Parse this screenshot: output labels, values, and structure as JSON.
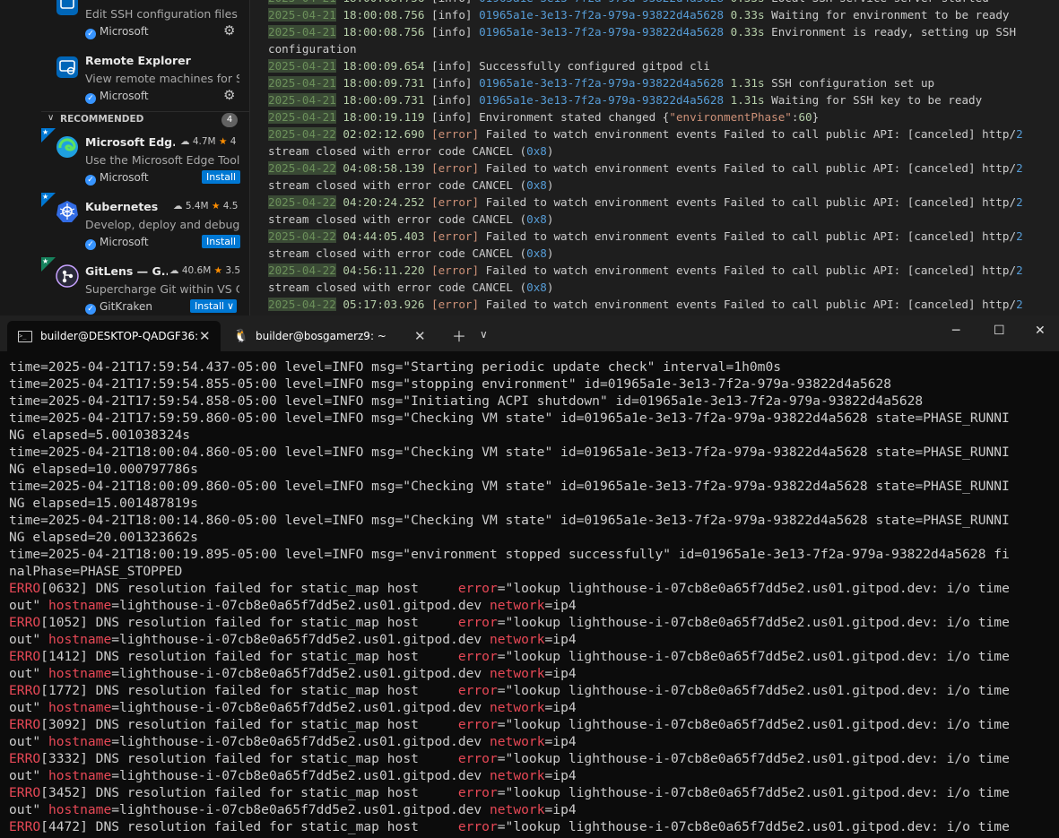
{
  "sidebar": {
    "installed": [
      {
        "title": "",
        "desc": "Edit SSH configuration files",
        "publisher": "Microsoft"
      },
      {
        "title": "Remote Explorer",
        "desc": "View remote machines for S...",
        "publisher": "Microsoft"
      }
    ],
    "recommended_label": "RECOMMENDED",
    "recommended_count": "4",
    "recommended": [
      {
        "title": "Microsoft Edg...",
        "downloads": "4.7M",
        "rating": "4",
        "desc": "Use the Microsoft Edge Tool...",
        "publisher": "Microsoft",
        "install": "Install"
      },
      {
        "title": "Kubernetes",
        "downloads": "5.4M",
        "rating": "4.5",
        "desc": "Develop, deploy and debug ...",
        "publisher": "Microsoft",
        "install": "Install"
      },
      {
        "title": "GitLens — G...",
        "downloads": "40.6M",
        "rating": "3.5",
        "desc": "Supercharge Git within VS C...",
        "publisher": "GitKraken",
        "install": "Install"
      }
    ]
  },
  "output_lines": [
    {
      "d": "2025-04-21",
      "t": " 18:00:08.756 ",
      "lvl": "[info]",
      "id": "01965a1e-3e13-7f2a-979a-93822d4a5628",
      "num": "0.33s",
      "rest": " Local SSH service server started"
    },
    {
      "d": "2025-04-21",
      "t": " 18:00:08.756 ",
      "lvl": "[info]",
      "id": "01965a1e-3e13-7f2a-979a-93822d4a5628",
      "num": "0.33s",
      "rest": " Waiting for environment to be ready"
    },
    {
      "d": "2025-04-21",
      "t": " 18:00:08.756 ",
      "lvl": "[info]",
      "id": "01965a1e-3e13-7f2a-979a-93822d4a5628",
      "num": "0.33s",
      "rest": " Environment is ready, setting up SSH"
    },
    {
      "plain": "configuration"
    },
    {
      "d": "2025-04-21",
      "t": " 18:00:09.654 ",
      "lvl": "[info]",
      "rest": "Successfully configured gitpod cli"
    },
    {
      "d": "2025-04-21",
      "t": " 18:00:09.731 ",
      "lvl": "[info]",
      "id": "01965a1e-3e13-7f2a-979a-93822d4a5628",
      "num": "1.31s",
      "rest": " SSH configuration set up"
    },
    {
      "d": "2025-04-21",
      "t": " 18:00:09.731 ",
      "lvl": "[info]",
      "id": "01965a1e-3e13-7f2a-979a-93822d4a5628",
      "num": "1.31s",
      "rest": " Waiting for SSH key to be ready"
    },
    {
      "d": "2025-04-21",
      "t": " 18:00:19.119 ",
      "lvl": "[info]",
      "rest": "Environment stated changed {",
      "str": "\"environmentPhase\"",
      "rest2": ":",
      "num2": "60",
      "rest3": "}"
    },
    {
      "d": "2025-04-22",
      "t": " 02:02:12.690 ",
      "lvl": "[error]",
      "err": true,
      "rest": "Failed to watch environment events Failed to call public API: [canceled] http/",
      "num": "2"
    },
    {
      "cont": "stream closed with error code CANCEL (",
      "hex": "0x8",
      "close": ")"
    },
    {
      "d": "2025-04-22",
      "t": " 04:08:58.139 ",
      "lvl": "[error]",
      "err": true,
      "rest": "Failed to watch environment events Failed to call public API: [canceled] http/",
      "num": "2"
    },
    {
      "cont": "stream closed with error code CANCEL (",
      "hex": "0x8",
      "close": ")"
    },
    {
      "d": "2025-04-22",
      "t": " 04:20:24.252 ",
      "lvl": "[error]",
      "err": true,
      "rest": "Failed to watch environment events Failed to call public API: [canceled] http/",
      "num": "2"
    },
    {
      "cont": "stream closed with error code CANCEL (",
      "hex": "0x8",
      "close": ")"
    },
    {
      "d": "2025-04-22",
      "t": " 04:44:05.403 ",
      "lvl": "[error]",
      "err": true,
      "rest": "Failed to watch environment events Failed to call public API: [canceled] http/",
      "num": "2"
    },
    {
      "cont": "stream closed with error code CANCEL (",
      "hex": "0x8",
      "close": ")"
    },
    {
      "d": "2025-04-22",
      "t": " 04:56:11.220 ",
      "lvl": "[error]",
      "err": true,
      "rest": "Failed to watch environment events Failed to call public API: [canceled] http/",
      "num": "2"
    },
    {
      "cont": "stream closed with error code CANCEL (",
      "hex": "0x8",
      "close": ")"
    },
    {
      "d": "2025-04-22",
      "t": " 05:17:03.926 ",
      "lvl": "[error]",
      "err": true,
      "rest": "Failed to watch environment events Failed to call public API: [canceled] http/",
      "num": "2"
    }
  ],
  "tabs": [
    {
      "label": "builder@DESKTOP-QADGF36:",
      "active": true
    },
    {
      "label": "builder@bosgamerz9: ~",
      "active": false
    }
  ],
  "terminal_lines": [
    {
      "text": "time=2025-04-21T17:59:54.437-05:00 level=INFO msg=\"Starting periodic update check\" interval=1h0m0s"
    },
    {
      "text": "time=2025-04-21T17:59:54.855-05:00 level=INFO msg=\"stopping environment\" id=01965a1e-3e13-7f2a-979a-93822d4a5628"
    },
    {
      "text": "time=2025-04-21T17:59:54.858-05:00 level=INFO msg=\"Initiating ACPI shutdown\" id=01965a1e-3e13-7f2a-979a-93822d4a5628"
    },
    {
      "text": "time=2025-04-21T17:59:59.860-05:00 level=INFO msg=\"Checking VM state\" id=01965a1e-3e13-7f2a-979a-93822d4a5628 state=PHASE_RUNNI"
    },
    {
      "text": "NG elapsed=5.001038324s"
    },
    {
      "text": "time=2025-04-21T18:00:04.860-05:00 level=INFO msg=\"Checking VM state\" id=01965a1e-3e13-7f2a-979a-93822d4a5628 state=PHASE_RUNNI"
    },
    {
      "text": "NG elapsed=10.000797786s"
    },
    {
      "text": "time=2025-04-21T18:00:09.860-05:00 level=INFO msg=\"Checking VM state\" id=01965a1e-3e13-7f2a-979a-93822d4a5628 state=PHASE_RUNNI"
    },
    {
      "text": "NG elapsed=15.001487819s"
    },
    {
      "text": "time=2025-04-21T18:00:14.860-05:00 level=INFO msg=\"Checking VM state\" id=01965a1e-3e13-7f2a-979a-93822d4a5628 state=PHASE_RUNNI"
    },
    {
      "text": "NG elapsed=20.001323662s"
    },
    {
      "text": "time=2025-04-21T18:00:19.895-05:00 level=INFO msg=\"environment stopped successfully\" id=01965a1e-3e13-7f2a-979a-93822d4a5628 fi"
    },
    {
      "text": "nalPhase=PHASE_STOPPED"
    },
    {
      "erro": "ERRO",
      "code": "[0632]"
    },
    {
      "cont": true
    },
    {
      "erro": "ERRO",
      "code": "[1052]"
    },
    {
      "cont": true
    },
    {
      "erro": "ERRO",
      "code": "[1412]"
    },
    {
      "cont": true
    },
    {
      "erro": "ERRO",
      "code": "[1772]"
    },
    {
      "cont": true
    },
    {
      "erro": "ERRO",
      "code": "[3092]"
    },
    {
      "cont": true
    },
    {
      "erro": "ERRO",
      "code": "[3332]"
    },
    {
      "cont": true
    },
    {
      "erro": "ERRO",
      "code": "[3452]"
    },
    {
      "cont": true
    },
    {
      "erro": "ERRO",
      "code": "[4472]"
    }
  ],
  "dns_error": {
    "msg": " DNS resolution failed for static_map host     ",
    "error_key": "error",
    "error_val": "=\"lookup lighthouse-i-07cb8e0a65f7dd5e2.us01.gitpod.dev: i/o time",
    "cont_start": "out\" ",
    "hostname_key": "hostname",
    "hostname_val": "=lighthouse-i-07cb8e0a65f7dd5e2.us01.gitpod.dev ",
    "network_key": "network",
    "network_val": "=ip4"
  }
}
